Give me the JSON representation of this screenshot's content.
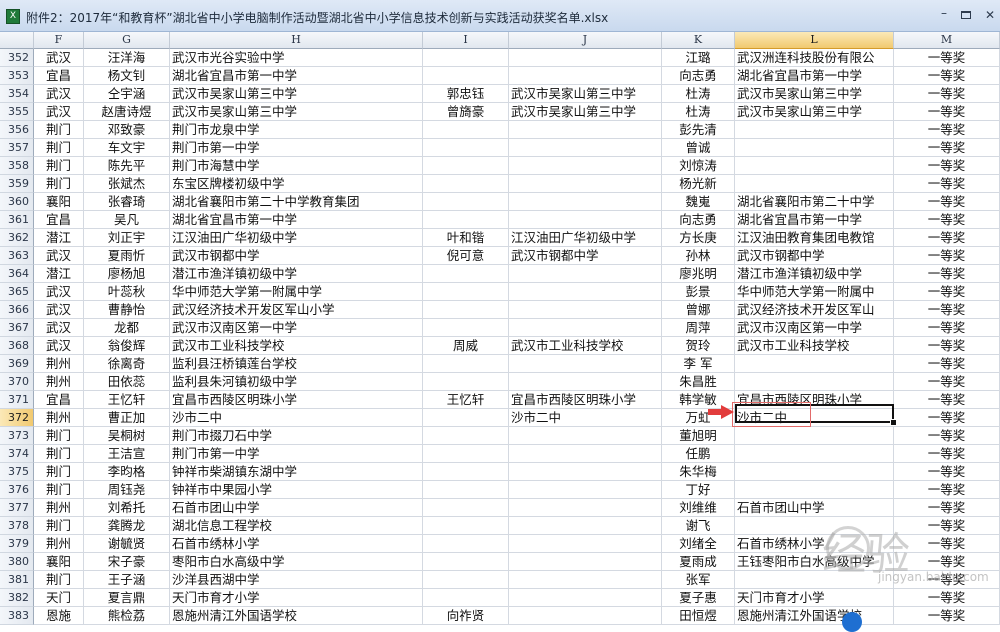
{
  "window": {
    "title": "附件2：2017年“和教育杯”湖北省中小学电脑制作活动暨湖北省中小学信息技术创新与实践活动获奖名单.xlsx"
  },
  "columns": [
    "F",
    "G",
    "H",
    "I",
    "J",
    "K",
    "L",
    "M"
  ],
  "selected_column": "L",
  "selected_row": "372",
  "active_cell": {
    "address": "L372",
    "value": "沙市二中"
  },
  "rows": [
    {
      "n": "352",
      "F": "武汉",
      "G": "汪洋海",
      "H": "武汉市光谷实验中学",
      "I": "",
      "J": "",
      "K": "江璐",
      "L": "武汉洲连科技股份有限公",
      "M": "一等奖"
    },
    {
      "n": "353",
      "F": "宜昌",
      "G": "杨文钊",
      "H": "湖北省宜昌市第一中学",
      "I": "",
      "J": "",
      "K": "向志勇",
      "L": "湖北省宜昌市第一中学",
      "M": "一等奖"
    },
    {
      "n": "354",
      "F": "武汉",
      "G": "仝宇涵",
      "H": "武汉市吴家山第三中学",
      "I": "郭忠钰",
      "J": "武汉市吴家山第三中学",
      "K": "杜涛",
      "L": "武汉市吴家山第三中学",
      "M": "一等奖"
    },
    {
      "n": "355",
      "F": "武汉",
      "G": "赵唐诗煜",
      "H": "武汉市吴家山第三中学",
      "I": "曾旖豪",
      "J": "武汉市吴家山第三中学",
      "K": "杜涛",
      "L": "武汉市吴家山第三中学",
      "M": "一等奖"
    },
    {
      "n": "356",
      "F": "荆门",
      "G": "邓致豪",
      "H": "荆门市龙泉中学",
      "I": "",
      "J": "",
      "K": "彭先清",
      "L": "",
      "M": "一等奖"
    },
    {
      "n": "357",
      "F": "荆门",
      "G": "车文宇",
      "H": "荆门市第一中学",
      "I": "",
      "J": "",
      "K": "曾诚",
      "L": "",
      "M": "一等奖"
    },
    {
      "n": "358",
      "F": "荆门",
      "G": "陈先平",
      "H": "荆门市海慧中学",
      "I": "",
      "J": "",
      "K": "刘惊涛",
      "L": "",
      "M": "一等奖"
    },
    {
      "n": "359",
      "F": "荆门",
      "G": "张斌杰",
      "H": "东宝区牌楼初级中学",
      "I": "",
      "J": "",
      "K": "杨光新",
      "L": "",
      "M": "一等奖"
    },
    {
      "n": "360",
      "F": "襄阳",
      "G": "张睿琦",
      "H": "湖北省襄阳市第二十中学教育集团",
      "I": "",
      "J": "",
      "K": "魏嵬",
      "L": "湖北省襄阳市第二十中学",
      "M": "一等奖"
    },
    {
      "n": "361",
      "F": "宜昌",
      "G": "吴凡",
      "H": "湖北省宜昌市第一中学",
      "I": "",
      "J": "",
      "K": "向志勇",
      "L": "湖北省宜昌市第一中学",
      "M": "一等奖"
    },
    {
      "n": "362",
      "F": "潜江",
      "G": "刘正宇",
      "H": "江汉油田广华初级中学",
      "I": "叶和锴",
      "J": "江汉油田广华初级中学",
      "K": "方长庚",
      "L": "江汉油田教育集团电教馆",
      "M": "一等奖"
    },
    {
      "n": "363",
      "F": "武汉",
      "G": "夏雨忻",
      "H": "武汉市钢都中学",
      "I": "倪可意",
      "J": "武汉市钢都中学",
      "K": "孙林",
      "L": "武汉市钢都中学",
      "M": "一等奖"
    },
    {
      "n": "364",
      "F": "潜江",
      "G": "廖杨旭",
      "H": "潜江市渔洋镇初级中学",
      "I": "",
      "J": "",
      "K": "廖兆明",
      "L": "潜江市渔洋镇初级中学",
      "M": "一等奖"
    },
    {
      "n": "365",
      "F": "武汉",
      "G": "叶蕊秋",
      "H": "华中师范大学第一附属中学",
      "I": "",
      "J": "",
      "K": "彭景",
      "L": "华中师范大学第一附属中",
      "M": "一等奖"
    },
    {
      "n": "366",
      "F": "武汉",
      "G": "曹静怡",
      "H": "武汉经济技术开发区军山小学",
      "I": "",
      "J": "",
      "K": "曾娜",
      "L": "武汉经济技术开发区军山",
      "M": "一等奖"
    },
    {
      "n": "367",
      "F": "武汉",
      "G": "龙都",
      "H": "武汉市汉南区第一中学",
      "I": "",
      "J": "",
      "K": "周萍",
      "L": "武汉市汉南区第一中学",
      "M": "一等奖"
    },
    {
      "n": "368",
      "F": "武汉",
      "G": "翁俊辉",
      "H": "武汉市工业科技学校",
      "I": "周威",
      "J": "武汉市工业科技学校",
      "K": "贺玲",
      "L": "武汉市工业科技学校",
      "M": "一等奖"
    },
    {
      "n": "369",
      "F": "荆州",
      "G": "徐离奇",
      "H": "监利县汪桥镇莲台学校",
      "I": "",
      "J": "",
      "K": "李 军",
      "L": "",
      "M": "一等奖"
    },
    {
      "n": "370",
      "F": "荆州",
      "G": "田依蕊",
      "H": "监利县朱河镇初级中学",
      "I": "",
      "J": "",
      "K": "朱昌胜",
      "L": "",
      "M": "一等奖"
    },
    {
      "n": "371",
      "F": "宜昌",
      "G": "王忆轩",
      "H": "宜昌市西陵区明珠小学",
      "I": "王忆轩",
      "J": "宜昌市西陵区明珠小学",
      "K": "韩学敏",
      "L": "宜昌市西陵区明珠小学",
      "M": "一等奖"
    },
    {
      "n": "372",
      "F": "荆州",
      "G": "曹正加",
      "H": "沙市二中",
      "I": "",
      "J": "沙市二中",
      "K": "万虹",
      "L": "沙市二中",
      "M": "一等奖"
    },
    {
      "n": "373",
      "F": "荆门",
      "G": "吴桐树",
      "H": "荆门市掇刀石中学",
      "I": "",
      "J": "",
      "K": "董旭明",
      "L": "",
      "M": "一等奖"
    },
    {
      "n": "374",
      "F": "荆门",
      "G": "王洁宣",
      "H": "荆门市第一中学",
      "I": "",
      "J": "",
      "K": "任鹏",
      "L": "",
      "M": "一等奖"
    },
    {
      "n": "375",
      "F": "荆门",
      "G": "李昀格",
      "H": "钟祥市柴湖镇东湖中学",
      "I": "",
      "J": "",
      "K": "朱华梅",
      "L": "",
      "M": "一等奖"
    },
    {
      "n": "376",
      "F": "荆门",
      "G": "周钰尧",
      "H": "钟祥市中果园小学",
      "I": "",
      "J": "",
      "K": "丁好",
      "L": "",
      "M": "一等奖"
    },
    {
      "n": "377",
      "F": "荆州",
      "G": "刘希托",
      "H": "石首市团山中学",
      "I": "",
      "J": "",
      "K": "刘维维",
      "L": "石首市团山中学",
      "M": "一等奖"
    },
    {
      "n": "378",
      "F": "荆门",
      "G": "龚腾龙",
      "H": "湖北信息工程学校",
      "I": "",
      "J": "",
      "K": "谢飞",
      "L": "",
      "M": "一等奖"
    },
    {
      "n": "379",
      "F": "荆州",
      "G": "谢毓贤",
      "H": "石首市绣林小学",
      "I": "",
      "J": "",
      "K": "刘绪全",
      "L": "石首市绣林小学",
      "M": "一等奖"
    },
    {
      "n": "380",
      "F": "襄阳",
      "G": "宋子豪",
      "H": "枣阳市白水高级中学",
      "I": "",
      "J": "",
      "K": "夏雨成",
      "L": "王钰枣阳市白水高级中学",
      "M": "一等奖"
    },
    {
      "n": "381",
      "F": "荆门",
      "G": "王子涵",
      "H": "沙洋县西湖中学",
      "I": "",
      "J": "",
      "K": "张军",
      "L": "",
      "M": "一等奖"
    },
    {
      "n": "382",
      "F": "天门",
      "G": "夏言鼎",
      "H": "天门市育才小学",
      "I": "",
      "J": "",
      "K": "夏子惠",
      "L": "天门市育才小学",
      "M": "一等奖"
    },
    {
      "n": "383",
      "F": "恩施",
      "G": "熊检荔",
      "H": "恩施州清江外国语学校",
      "I": "向祚贤",
      "J": "",
      "K": "田恒煜",
      "L": "恩施州清江外国语学校",
      "M": "一等奖"
    }
  ],
  "watermark": {
    "text": "经验",
    "sub": "jingyan.baidu.com"
  }
}
